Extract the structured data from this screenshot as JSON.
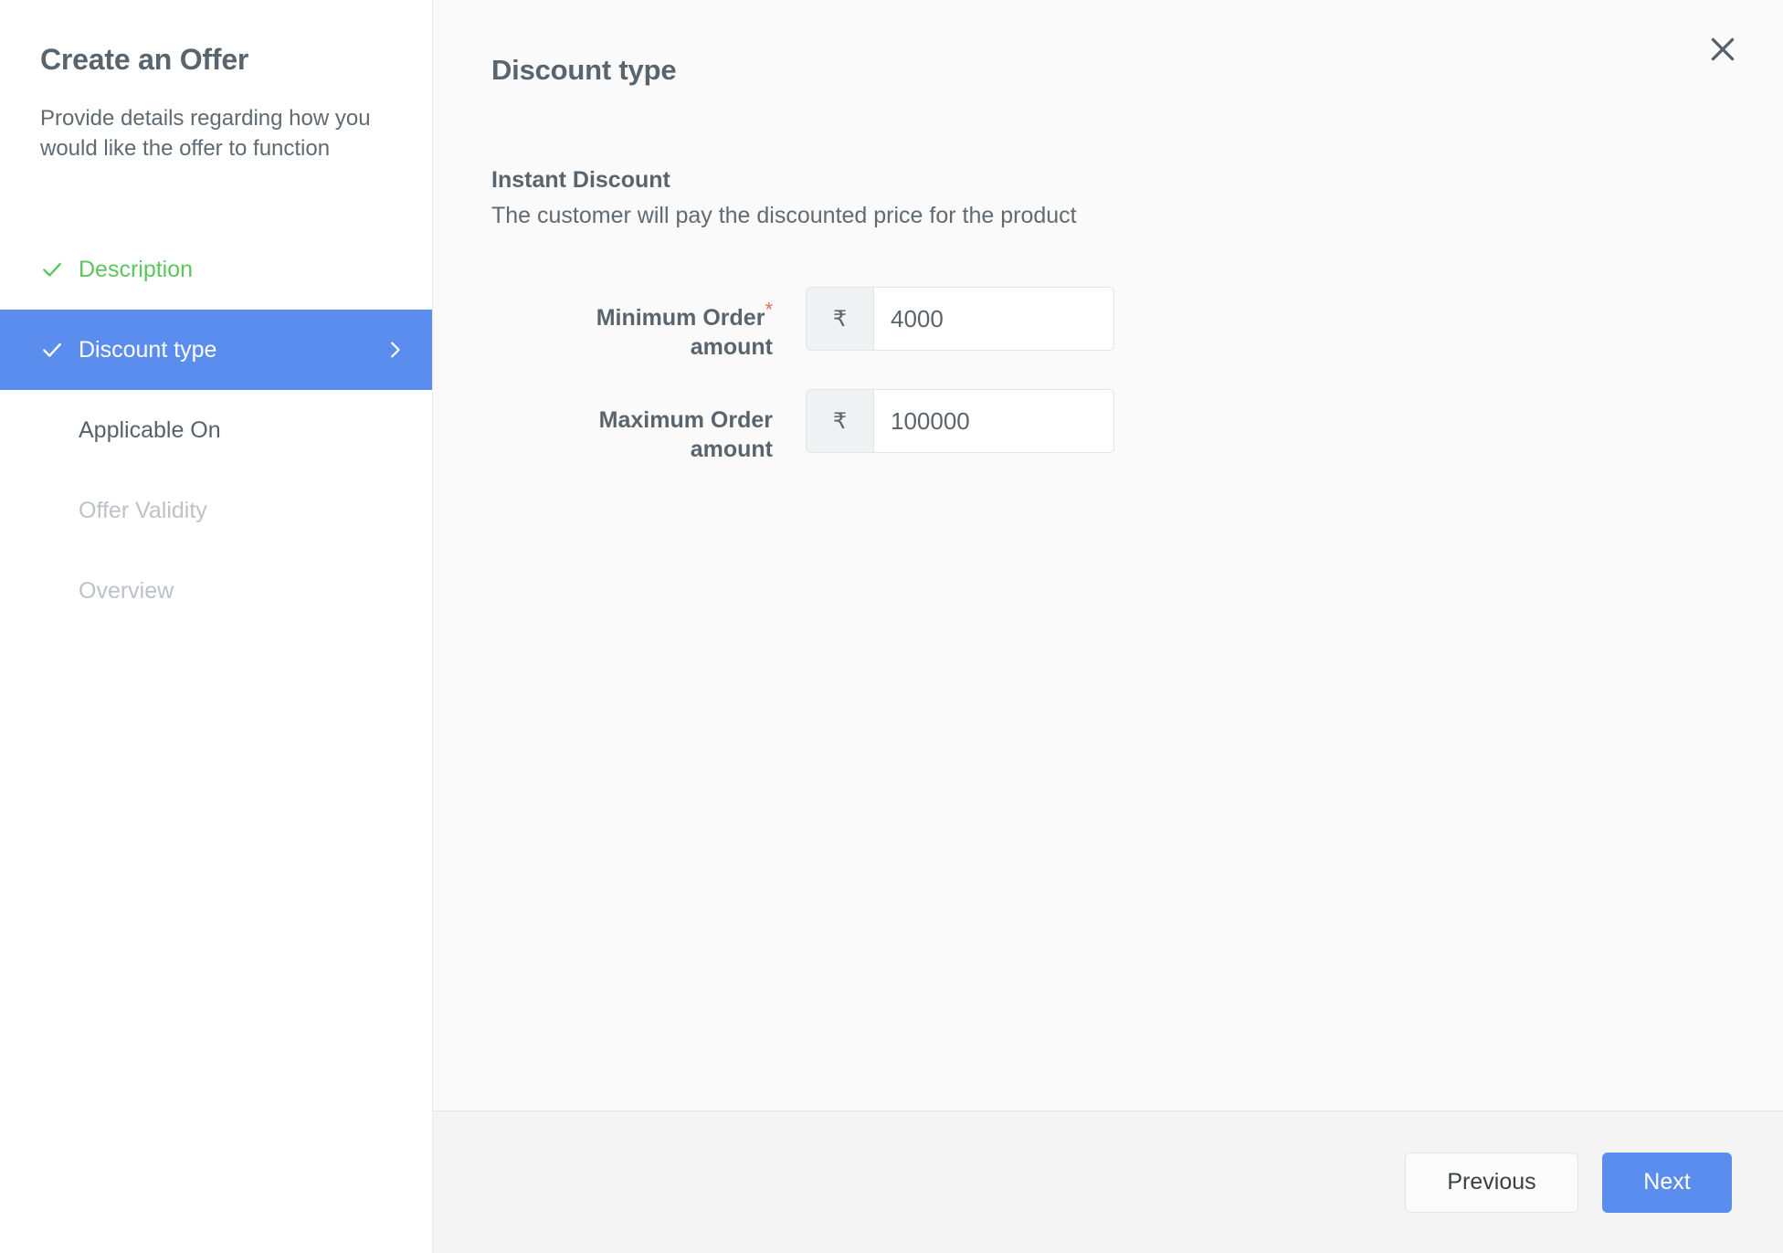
{
  "sidebar": {
    "title": "Create an Offer",
    "description": "Provide details regarding how you would like the offer to function",
    "steps": [
      {
        "label": "Description",
        "state": "done",
        "check": true,
        "chevron": false
      },
      {
        "label": "Discount type",
        "state": "active",
        "check": true,
        "chevron": true
      },
      {
        "label": "Applicable On",
        "state": "enabled",
        "check": false,
        "chevron": false
      },
      {
        "label": "Offer Validity",
        "state": "disabled",
        "check": false,
        "chevron": false
      },
      {
        "label": "Overview",
        "state": "disabled",
        "check": false,
        "chevron": false
      }
    ]
  },
  "main": {
    "title": "Discount type",
    "close_icon": "close-icon",
    "section": {
      "title": "Instant Discount",
      "subtitle": "The customer will pay the discounted price for the product"
    },
    "fields": [
      {
        "label": "Minimum Order",
        "label_line2": "amount",
        "required": true,
        "required_mark": "*",
        "currency": "₹",
        "value": "4000",
        "placeholder": ""
      },
      {
        "label": "Maximum Order",
        "label_line2": "amount",
        "required": false,
        "required_mark": "",
        "currency": "₹",
        "value": "100000",
        "placeholder": ""
      }
    ]
  },
  "footer": {
    "previous_label": "Previous",
    "next_label": "Next"
  },
  "colors": {
    "accent_blue": "#5b8def",
    "done_green": "#5cc65c",
    "required_red": "#ea6a5e",
    "text_slate": "#5a646d",
    "disabled_gray": "#bcc2c8",
    "panel_bg": "#fafafa",
    "footer_bg": "#f4f4f5"
  }
}
